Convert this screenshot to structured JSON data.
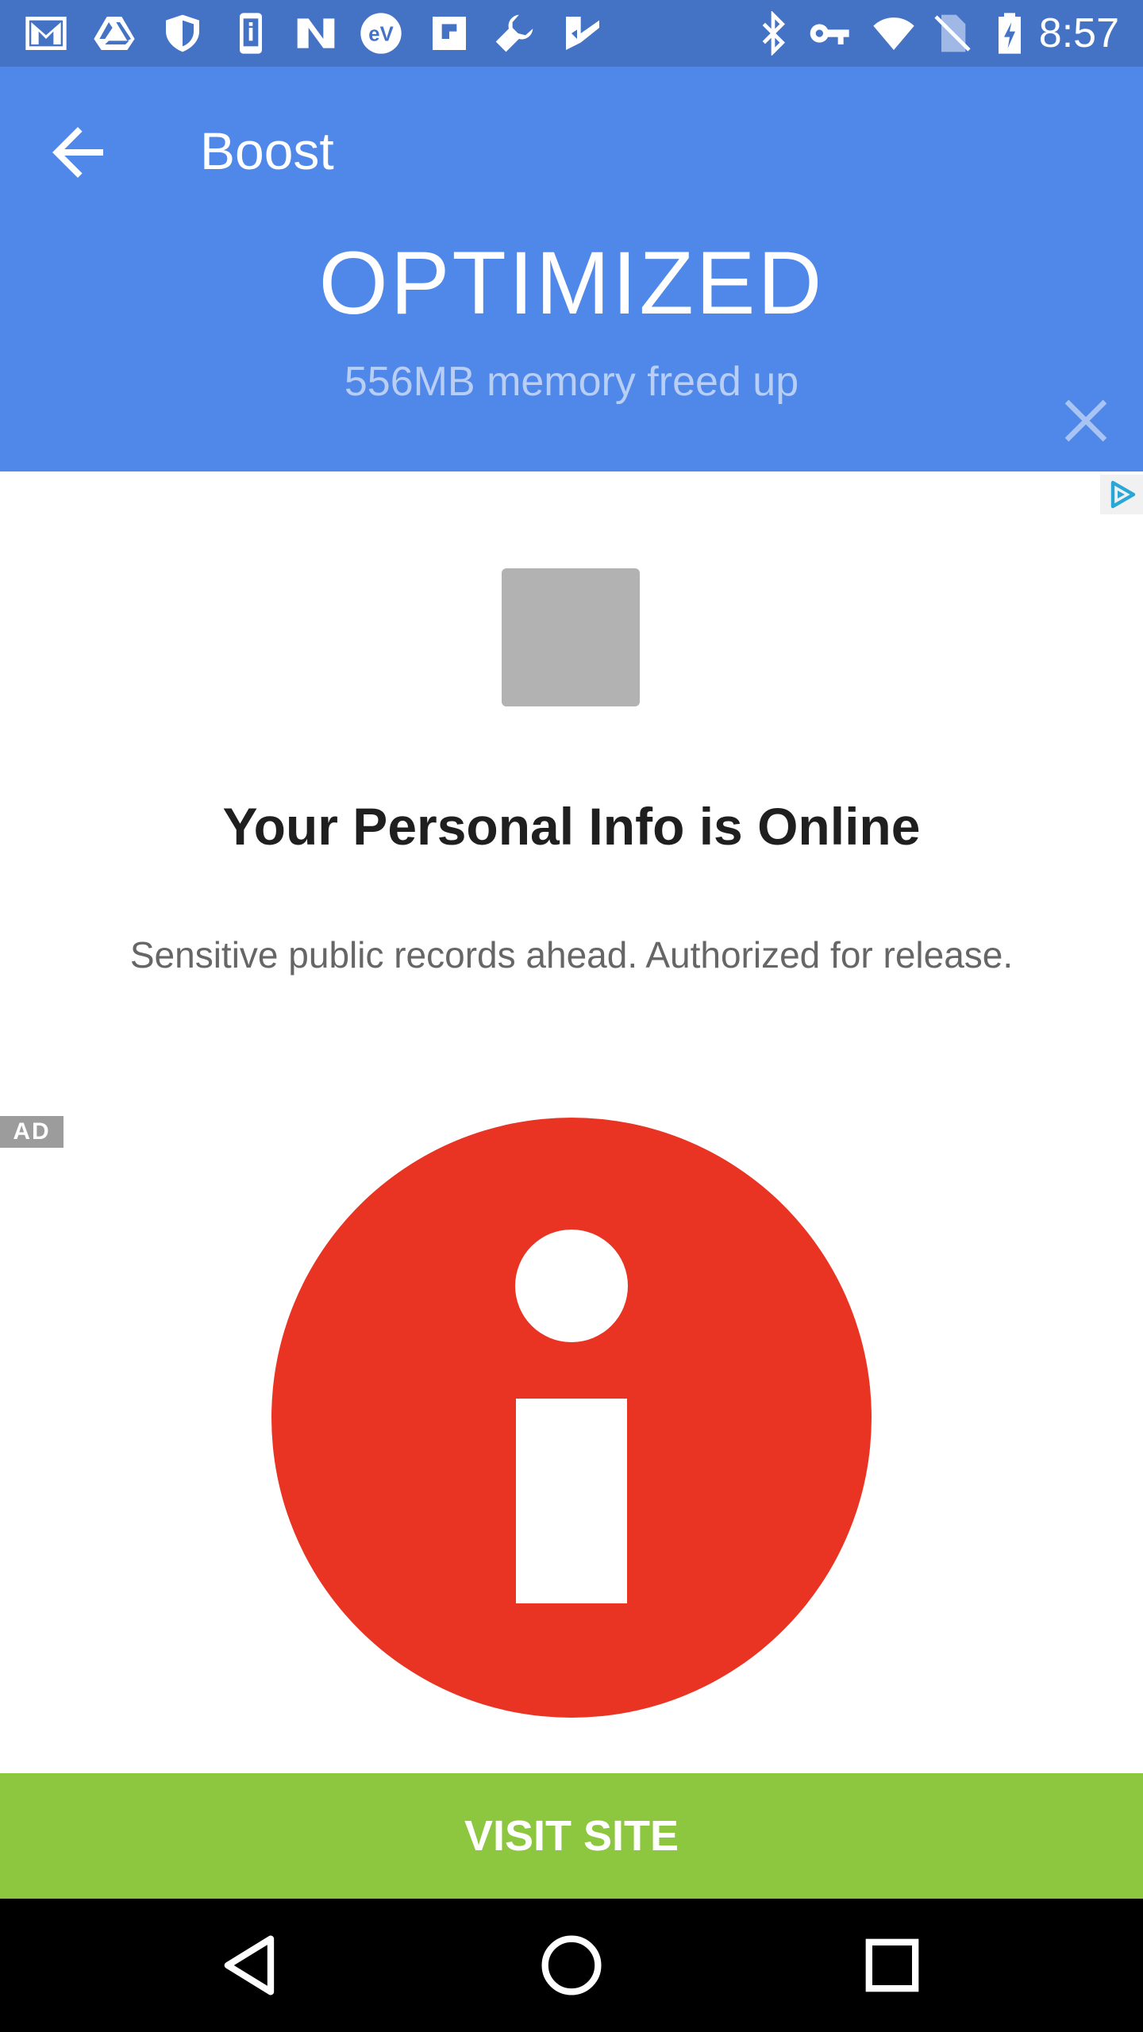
{
  "status_bar": {
    "time": "8:57",
    "left_icons": [
      "gmail-icon",
      "drive-icon",
      "shield-icon",
      "phone-info-icon",
      "nav-n-icon",
      "ev-icon",
      "flipboard-icon",
      "wrench-icon",
      "checkmark-app-icon"
    ],
    "right_icons": [
      "bluetooth-icon",
      "vpn-key-icon",
      "wifi-icon",
      "no-sim-icon",
      "battery-charging-icon"
    ]
  },
  "app_bar": {
    "title": "Boost",
    "back_icon": "arrow-back-icon"
  },
  "result": {
    "title": "OPTIMIZED",
    "subtitle": "556MB memory freed up",
    "close_icon": "close-icon"
  },
  "ad": {
    "badge": "AD",
    "adchoices_icon": "adchoices-icon",
    "headline": "Your Personal Info is Online",
    "body": "Sensitive public records ahead. Authorized for release.",
    "cta_label": "VISIT SITE",
    "graphic_icon": "info-icon"
  },
  "nav_bar": {
    "icons": [
      "back-triangle-icon",
      "home-circle-icon",
      "recents-square-icon"
    ]
  },
  "colors": {
    "status_bar": "#4472C4",
    "app_bar": "#4F88E8",
    "cta": "#8DC63F",
    "info_red": "#E93323"
  }
}
